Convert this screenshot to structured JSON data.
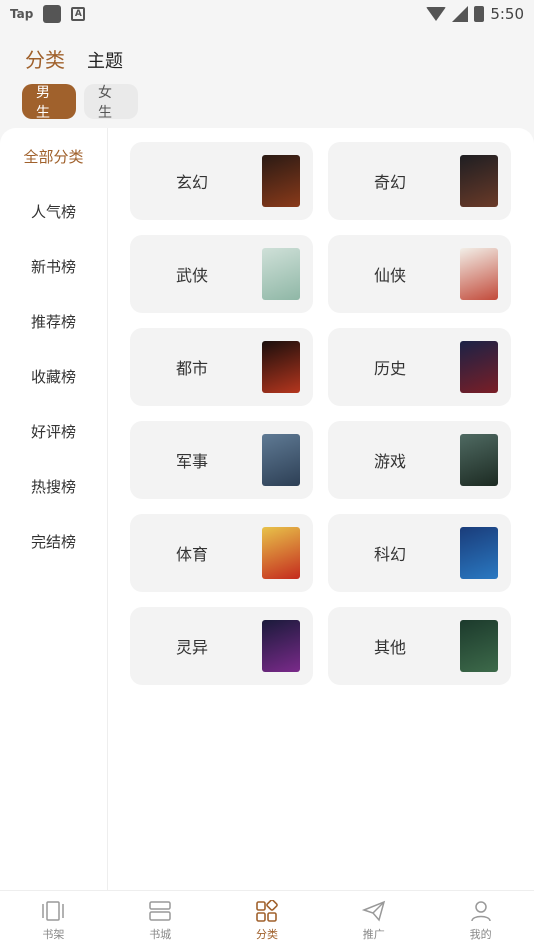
{
  "statusbar": {
    "app_label": "Tap",
    "time": "5:50"
  },
  "header": {
    "tabs": [
      {
        "label": "分类",
        "active": true
      },
      {
        "label": "主题",
        "active": false
      }
    ]
  },
  "gender": {
    "male": "男生",
    "female": "女生",
    "selected": "男生"
  },
  "sidebar": {
    "items": [
      {
        "label": "全部分类",
        "active": true
      },
      {
        "label": "人气榜"
      },
      {
        "label": "新书榜"
      },
      {
        "label": "推荐榜"
      },
      {
        "label": "收藏榜"
      },
      {
        "label": "好评榜"
      },
      {
        "label": "热搜榜"
      },
      {
        "label": "完结榜"
      }
    ]
  },
  "categories": [
    {
      "label": "玄幻",
      "cover_colors": [
        "#2a1a14",
        "#8a3a1a"
      ]
    },
    {
      "label": "奇幻",
      "cover_colors": [
        "#1e1e22",
        "#6a3a28"
      ]
    },
    {
      "label": "武侠",
      "cover_colors": [
        "#cfe0d8",
        "#8fb7a6"
      ]
    },
    {
      "label": "仙侠",
      "cover_colors": [
        "#f2efe8",
        "#c24a3a"
      ]
    },
    {
      "label": "都市",
      "cover_colors": [
        "#1a0e0c",
        "#b5361e"
      ]
    },
    {
      "label": "历史",
      "cover_colors": [
        "#1b2246",
        "#7a1e26"
      ]
    },
    {
      "label": "军事",
      "cover_colors": [
        "#5f7a94",
        "#2d3f55"
      ]
    },
    {
      "label": "游戏",
      "cover_colors": [
        "#4f6a62",
        "#1c2a22"
      ]
    },
    {
      "label": "体育",
      "cover_colors": [
        "#e8c34a",
        "#c42a1e"
      ]
    },
    {
      "label": "科幻",
      "cover_colors": [
        "#1a3c7a",
        "#2a79c2"
      ]
    },
    {
      "label": "灵异",
      "cover_colors": [
        "#1a1a3a",
        "#7a2a8a"
      ]
    },
    {
      "label": "其他",
      "cover_colors": [
        "#1c3a2c",
        "#3d6a4a"
      ]
    }
  ],
  "bottomnav": {
    "items": [
      {
        "label": "书架",
        "icon": "bookshelf-icon"
      },
      {
        "label": "书城",
        "icon": "bookstore-icon"
      },
      {
        "label": "分类",
        "icon": "category-grid-icon",
        "active": true
      },
      {
        "label": "推广",
        "icon": "paper-plane-icon"
      },
      {
        "label": "我的",
        "icon": "profile-icon"
      }
    ]
  },
  "accent_color": "#a0612c"
}
